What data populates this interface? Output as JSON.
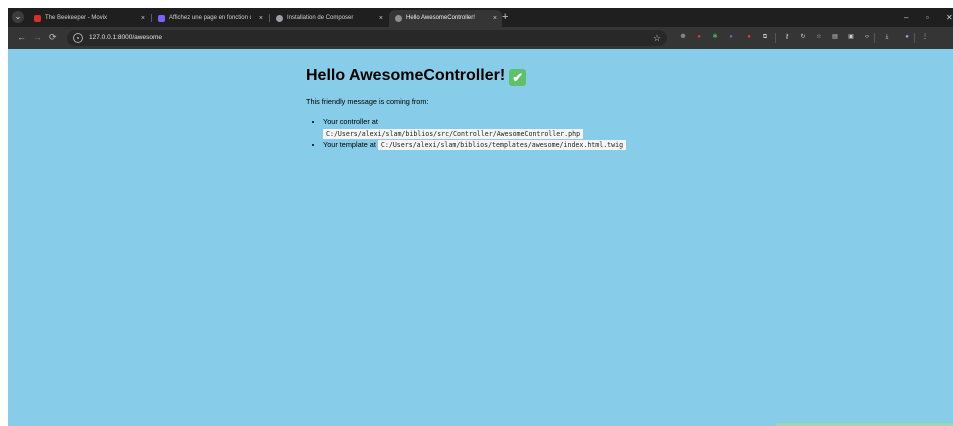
{
  "tabs": [
    {
      "label": "The Beekeeper - Movix",
      "favicon_color": "#d93025",
      "active": false
    },
    {
      "label": "Affichez une page en fonction d",
      "favicon_color": "#7b61ff",
      "active": false
    },
    {
      "label": "Installation de Composer",
      "favicon_color": "#9aa0a6",
      "active": false
    },
    {
      "label": "Hello AwesomeController!",
      "favicon_color": "#8e8e8e",
      "active": true
    }
  ],
  "tab_close_glyph": "×",
  "new_tab_glyph": "+",
  "window_controls": {
    "minimize": "–",
    "restore": "▫",
    "close": "✕"
  },
  "toolbar": {
    "back_glyph": "←",
    "forward_glyph": "→",
    "reload_glyph": "⟳",
    "url": "127.0.0.1:8000/awesome",
    "bookmark_glyph": "☆"
  },
  "extensions": [
    {
      "name": "extension-owl-icon",
      "glyph": "❁",
      "color": "#bdbdbd"
    },
    {
      "name": "extension-adblock-icon",
      "glyph": "●",
      "color": "#e53935"
    },
    {
      "name": "extension-translate-icon",
      "glyph": "✱",
      "color": "#4caf50"
    },
    {
      "name": "extension-puzzle-color-icon",
      "glyph": "●",
      "color": "#5c6bc0"
    },
    {
      "name": "extension-red-icon",
      "glyph": "●",
      "color": "#e53935"
    },
    {
      "name": "extensions-puzzle-icon",
      "glyph": "⧉",
      "color": "#cfcfcf"
    },
    {
      "name": "password-key-icon",
      "glyph": "⚷",
      "color": "#cfcfcf"
    },
    {
      "name": "history-icon",
      "glyph": "↻",
      "color": "#cfcfcf"
    },
    {
      "name": "bookmarks-icon",
      "glyph": "☆",
      "color": "#cfcfcf"
    },
    {
      "name": "reading-list-icon",
      "glyph": "▤",
      "color": "#cfcfcf"
    },
    {
      "name": "tab-search-icon",
      "glyph": "▣",
      "color": "#cfcfcf"
    },
    {
      "name": "devtools-icon",
      "glyph": "‹›",
      "color": "#cfcfcf"
    },
    {
      "name": "download-icon",
      "glyph": "⤓",
      "color": "#cfcfcf"
    },
    {
      "name": "profile-avatar-icon",
      "glyph": "●",
      "color": "#c58af9"
    },
    {
      "name": "menu-icon",
      "glyph": "⋮",
      "color": "#cfcfcf"
    }
  ],
  "page": {
    "background": "#87CCE8",
    "heading": "Hello AwesomeController!",
    "check_glyph": "✔",
    "intro": "This friendly message is coming from:",
    "controller_label": "Your controller at",
    "controller_path": "C:/Users/alexi/slam/biblios/src/Controller/AwesomeController.php",
    "template_label": "Your template at",
    "template_path": "C:/Users/alexi/slam/biblios/templates/awesome/index.html.twig"
  }
}
